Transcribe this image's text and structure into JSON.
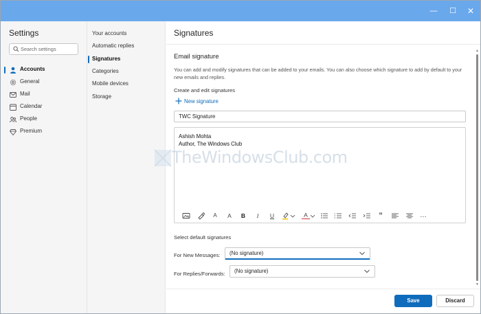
{
  "window": {
    "controls": {
      "minimize": "—",
      "maximize": "☐",
      "close": "✕"
    }
  },
  "leftnav": {
    "title": "Settings",
    "search_placeholder": "Search settings",
    "items": [
      {
        "label": "Accounts",
        "icon": "person-icon",
        "active": true
      },
      {
        "label": "General",
        "icon": "gear-icon",
        "active": false
      },
      {
        "label": "Mail",
        "icon": "mail-icon",
        "active": false
      },
      {
        "label": "Calendar",
        "icon": "calendar-icon",
        "active": false
      },
      {
        "label": "People",
        "icon": "people-icon",
        "active": false
      },
      {
        "label": "Premium",
        "icon": "diamond-icon",
        "active": false
      }
    ]
  },
  "subnav": {
    "items": [
      {
        "label": "Your accounts",
        "active": false
      },
      {
        "label": "Automatic replies",
        "active": false
      },
      {
        "label": "Signatures",
        "active": true
      },
      {
        "label": "Categories",
        "active": false
      },
      {
        "label": "Mobile devices",
        "active": false
      },
      {
        "label": "Storage",
        "active": false
      }
    ]
  },
  "content": {
    "title": "Signatures",
    "section_title": "Email signature",
    "description": "You can add and modify signatures that can be added to your emails. You can also choose which signature to add by default to your new emails and replies.",
    "create_label": "Create and edit signatures",
    "new_signature_label": "New signature",
    "signature_name": "TWC Signature",
    "signature_body": {
      "line1": "Ashish Mohta",
      "line2": "Author, The Windows Club"
    },
    "toolbar": {
      "font_size_glyph": "A",
      "superscript_glyph": "A",
      "bold_glyph": "B",
      "italic_glyph": "I",
      "underline_glyph": "U",
      "font_color_glyph": "A",
      "quote_glyph": "”",
      "more_glyph": "…"
    },
    "defaults_label": "Select default signatures",
    "new_messages_label": "For New Messages:",
    "new_messages_value": "(No signature)",
    "replies_label": "For Replies/Forwards:",
    "replies_value": "(No signature)",
    "save_label": "Save",
    "discard_label": "Discard"
  },
  "colors": {
    "titlebar": "#6aa8ec",
    "accent": "#0f6cbd",
    "highlight_yellow": "#f2c811",
    "font_color_red": "#d13438"
  },
  "watermark": {
    "text": "TheWindowsClub.com"
  }
}
